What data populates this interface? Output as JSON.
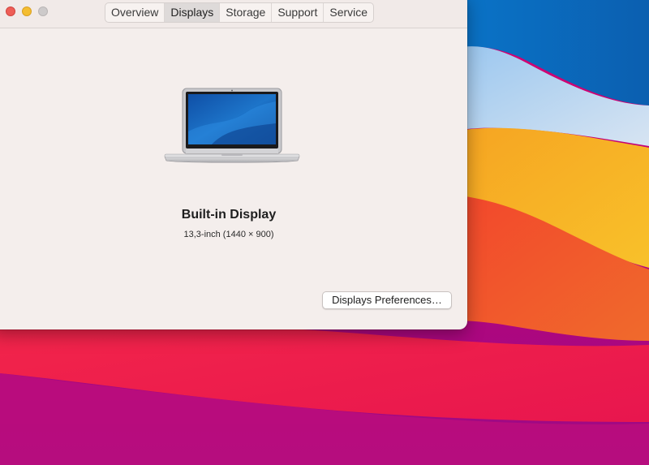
{
  "window": {
    "tabs": [
      {
        "label": "Overview",
        "active": false
      },
      {
        "label": "Displays",
        "active": true
      },
      {
        "label": "Storage",
        "active": false
      },
      {
        "label": "Support",
        "active": false
      },
      {
        "label": "Service",
        "active": false
      }
    ]
  },
  "display": {
    "name": "Built-in Display",
    "spec": "13,3-inch (1440 × 900)",
    "preferences_button": "Displays Preferences…"
  },
  "colors": {
    "close": "#ee5e57",
    "minimize": "#f4bd31",
    "zoom_inactive": "#cdcaca",
    "window_bg": "#f4eeec"
  },
  "icons": {
    "device": "macbook-air-icon"
  }
}
